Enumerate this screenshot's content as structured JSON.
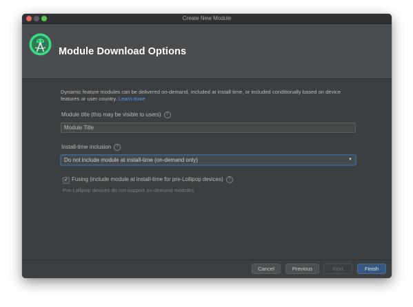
{
  "window": {
    "title": "Create New Module"
  },
  "header": {
    "title": "Module Download Options",
    "logo_icon": "android-studio-icon"
  },
  "description": {
    "text": "Dynamic feature modules can be delivered on-demand, included at install time, or included conditionally based on device features or user country.",
    "link_label": "Learn more"
  },
  "module_title": {
    "label": "Module title (this may be visible to users)",
    "value": "Module Title"
  },
  "install_time": {
    "label": "Install-time inclusion",
    "selected": "Do not include module at install-time (on-demand only)"
  },
  "fusing": {
    "checked": true,
    "label": "Fusing (include module at install-time for pre-Lollipop devices)",
    "note": "Pre-Lollipop devices do not support on-demand modules"
  },
  "footer": {
    "cancel": "Cancel",
    "previous": "Previous",
    "next": "Next",
    "finish": "Finish"
  },
  "colors": {
    "accent": "#365880",
    "link": "#589df6",
    "background": "#3c3f41",
    "header": "#4a4d50"
  }
}
